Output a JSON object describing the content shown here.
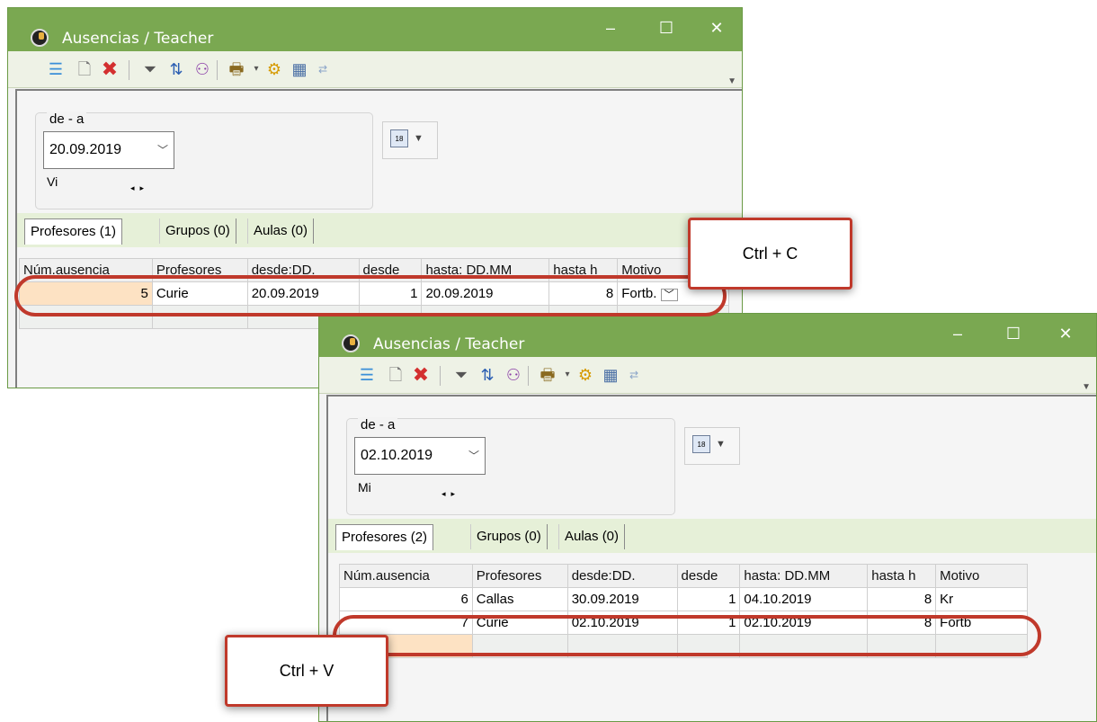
{
  "window1": {
    "title": "Ausencias / Teacher",
    "date_group_label": "de - a",
    "date_value": "20.09.2019",
    "day_label": "Vi",
    "tabs": [
      "Profesores (1)",
      "Grupos (0)",
      "Aulas (0)"
    ],
    "columns": [
      "Núm.ausencia",
      "Profesores",
      "desde:DD.",
      "desde",
      "hasta: DD.MM",
      "hasta h",
      "Motivo"
    ],
    "rows": [
      {
        "num": "5",
        "teacher": "Curie",
        "from_date": "20.09.2019",
        "from_h": "1",
        "to_date": "20.09.2019",
        "to_h": "8",
        "reason": "Fortb."
      }
    ]
  },
  "window2": {
    "title": "Ausencias / Teacher",
    "date_group_label": "de - a",
    "date_value": "02.10.2019",
    "day_label": "Mi",
    "tabs": [
      "Profesores (2)",
      "Grupos (0)",
      "Aulas (0)"
    ],
    "columns": [
      "Núm.ausencia",
      "Profesores",
      "desde:DD.",
      "desde",
      "hasta: DD.MM",
      "hasta h",
      "Motivo"
    ],
    "rows": [
      {
        "num": "6",
        "teacher": "Callas",
        "from_date": "30.09.2019",
        "from_h": "1",
        "to_date": "04.10.2019",
        "to_h": "8",
        "reason": "Kr"
      },
      {
        "num": "7",
        "teacher": "Curie",
        "from_date": "02.10.2019",
        "from_h": "1",
        "to_date": "02.10.2019",
        "to_h": "8",
        "reason": "Fortb"
      }
    ]
  },
  "window_controls": {
    "minimize": "–",
    "maximize": "☐",
    "close": "✕"
  },
  "callouts": {
    "copy": "Ctrl + C",
    "paste": "Ctrl + V"
  },
  "colors": {
    "titlebar": "#7aa851",
    "highlight_oval": "#c0392b",
    "selected_cell": "#fde2c3"
  }
}
